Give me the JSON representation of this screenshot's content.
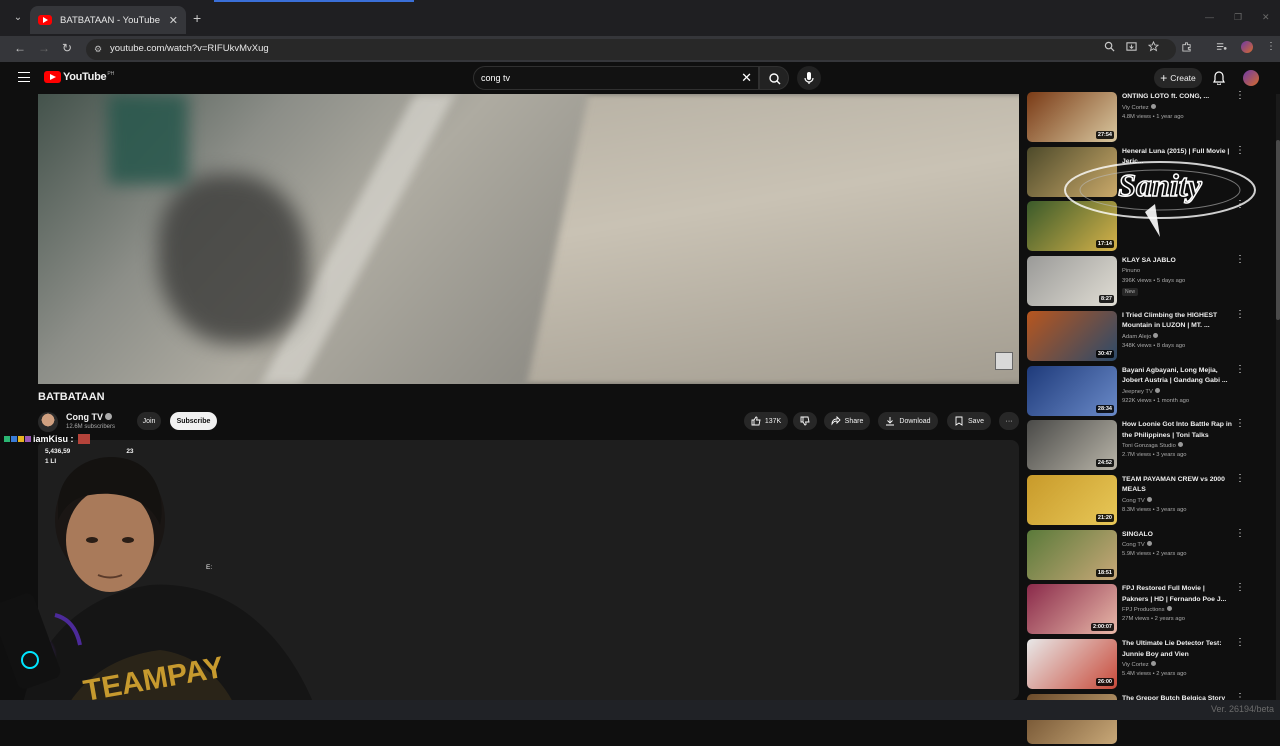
{
  "browser": {
    "tab_title": "BATBATAAN - YouTube",
    "tab_close": "✕",
    "new_tab": "+",
    "url": "youtube.com/watch?v=RIFUkvMvXug",
    "back": "←",
    "forward": "→",
    "reload": "↻",
    "site_info": "⚙",
    "win_min": "—",
    "win_max": "❐",
    "win_close": "✕"
  },
  "header": {
    "logo_text": "YouTube",
    "logo_region": "PH",
    "search_query": "cong tv",
    "search_clear": "✕",
    "create_label": "Create",
    "create_plus": "+"
  },
  "video": {
    "title": "BATBATAAN",
    "channel_name": "Cong TV",
    "channel_subs": "12.6M subscribers",
    "join_label": "Join",
    "subscribe_label": "Subscribe",
    "like_count": "137K",
    "share_label": "Share",
    "download_label": "Download",
    "save_label": "Save",
    "more": "···"
  },
  "description": {
    "views": "5,436,59",
    "views_tail": "23",
    "line2": "1 LI",
    "fragment": "E:"
  },
  "overlay": {
    "chat_user": "iamKisu :",
    "version": "Ver. 26194/beta",
    "logo_text": "Sanity"
  },
  "colors": {
    "accent_red": "#ff0000",
    "page_bg": "#0f0f0f"
  },
  "recommendations": [
    {
      "title": "ONTING LOTO ft. CONG, ...",
      "channel": "Viy Cortez",
      "verified": true,
      "meta": "4.8M views • 1 year ago",
      "duration": "27:54",
      "thumb": [
        "#7a3b16",
        "#d9c8a0"
      ]
    },
    {
      "title": "Heneral Luna (2015) | Full Movie | Jeric...",
      "channel": "",
      "verified": false,
      "meta": "",
      "duration": "",
      "thumb": [
        "#4d4a2a",
        "#caa96a"
      ]
    },
    {
      "title": "",
      "channel": "",
      "verified": false,
      "meta": "",
      "duration": "17:14",
      "thumb": [
        "#3a5a2a",
        "#d6b24a"
      ]
    },
    {
      "title": "KLAY SA JABLO",
      "channel": "Pinuno",
      "verified": false,
      "meta": "396K views • 5 days ago",
      "duration": "8:27",
      "new": "New",
      "thumb": [
        "#9a9a98",
        "#e0ddd4"
      ]
    },
    {
      "title": "I Tried Climbing the HIGHEST Mountain in LUZON | MT. ...",
      "channel": "Adam Alejo",
      "verified": true,
      "meta": "348K views • 8 days ago",
      "duration": "30:47",
      "thumb": [
        "#b8561e",
        "#2c4a6a"
      ]
    },
    {
      "title": "Bayani Agbayani, Long Mejia, Jobert Austria | Gandang Gabi ...",
      "channel": "Jeepney TV",
      "verified": true,
      "meta": "922K views • 1 month ago",
      "duration": "28:34",
      "thumb": [
        "#1e3a7a",
        "#6a8ac8"
      ]
    },
    {
      "title": "How Loonie Got Into Battle Rap in the Philippines | Toni Talks",
      "channel": "Toni Gonzaga Studio",
      "verified": true,
      "meta": "2.7M views • 3 years ago",
      "duration": "24:52",
      "thumb": [
        "#4a4a48",
        "#b8b4a8"
      ]
    },
    {
      "title": "TEAM PAYAMAN CREW vs 2000 MEALS",
      "channel": "Cong TV",
      "verified": true,
      "meta": "8.3M views • 3 years ago",
      "duration": "21:20",
      "thumb": [
        "#c89a2a",
        "#e8c858"
      ]
    },
    {
      "title": "SINGALO",
      "channel": "Cong TV",
      "verified": true,
      "meta": "5.9M views • 2 years ago",
      "duration": "18:51",
      "thumb": [
        "#5a7a3a",
        "#c8a878"
      ]
    },
    {
      "title": "FPJ Restored Full Movie | Pakners | HD | Fernando Poe J...",
      "channel": "FPJ Productions",
      "verified": true,
      "meta": "27M views • 2 years ago",
      "duration": "2:00:07",
      "thumb": [
        "#8a2a4a",
        "#e8b8a8"
      ]
    },
    {
      "title": "The Ultimate Lie Detector Test: Junnie Boy and Vien",
      "channel": "Viy Cortez",
      "verified": true,
      "meta": "5.4M views • 2 years ago",
      "duration": "26:00",
      "thumb": [
        "#e8e8e8",
        "#c84a3a"
      ]
    },
    {
      "title": "The Grepor Butch Belgica Story FULL MOVIE | Joko Diaz, ...",
      "channel": "",
      "verified": false,
      "meta": "",
      "duration": "",
      "thumb": [
        "#6a4a2a",
        "#c8a878"
      ]
    }
  ]
}
